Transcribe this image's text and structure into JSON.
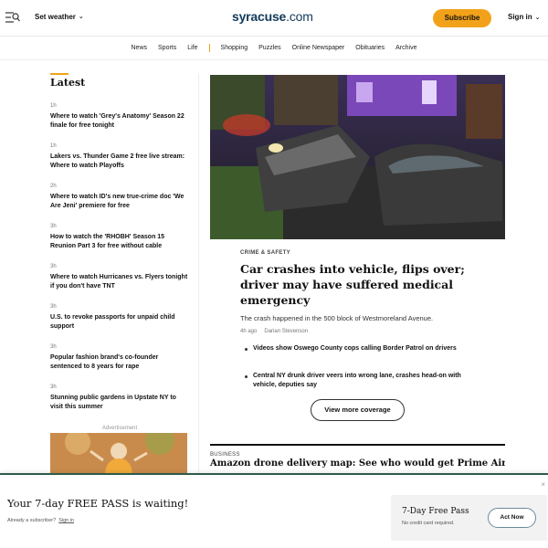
{
  "header": {
    "weather_label": "Set weather",
    "logo_main": "syracuse",
    "logo_suffix": ".com",
    "subscribe_label": "Subscribe",
    "signin_label": "Sign in"
  },
  "nav": {
    "items": [
      "News",
      "Sports",
      "Life",
      "Shopping",
      "Puzzles",
      "Online Newspaper",
      "Obituaries",
      "Archive"
    ]
  },
  "latest": {
    "title": "Latest",
    "items": [
      {
        "age": "1h",
        "title": "Where to watch 'Grey's Anatomy' Season 22 finale for free tonight"
      },
      {
        "age": "1h",
        "title": "Lakers vs. Thunder Game 2 free live stream: Where to watch Playoffs"
      },
      {
        "age": "2h",
        "title": "Where to watch ID's new true-crime doc 'We Are Jeni' premiere for free"
      },
      {
        "age": "3h",
        "title": "How to watch the 'RHOBH' Season 15 Reunion Part 3 for free without cable"
      },
      {
        "age": "3h",
        "title": "Where to watch Hurricanes vs. Flyers tonight if you don't have TNT"
      },
      {
        "age": "3h",
        "title": "U.S. to revoke passports for unpaid child support"
      },
      {
        "age": "3h",
        "title": "Popular fashion brand's co-founder sentenced to 8 years for rape"
      },
      {
        "age": "3h",
        "title": "Stunning public gardens in Upstate NY to visit this summer"
      }
    ],
    "ad_label": "Advertisement"
  },
  "main_story": {
    "kicker": "CRIME & SAFETY",
    "headline": "Car crashes into vehicle, flips over; driver may have suffered medical emergency",
    "dek": "The crash happened in the 500 block of Westmoreland Avenue.",
    "age": "4h ago",
    "author": "Darian Stevenson",
    "related": [
      "Videos show Oswego County cops calling Border Patrol on drivers",
      "Central NY drunk driver veers into wrong lane, crashes head-on with vehicle, deputies say"
    ],
    "more_label": "View more coverage"
  },
  "second_story": {
    "kicker": "BUSINESS",
    "headline": "Amazon drone delivery map: See who would get Prime Air"
  },
  "paywall": {
    "title": "Your 7-day FREE PASS is waiting!",
    "already": "Already a subscriber?",
    "signin_link": "Sign in",
    "offer_name": "7-Day Free Pass",
    "offer_note": "No credit card required.",
    "act_label": "Act Now",
    "close_glyph": "×"
  },
  "colors": {
    "accent": "#f2a21a",
    "brand": "#123a5a",
    "paywall_border": "#2f5a4a"
  }
}
